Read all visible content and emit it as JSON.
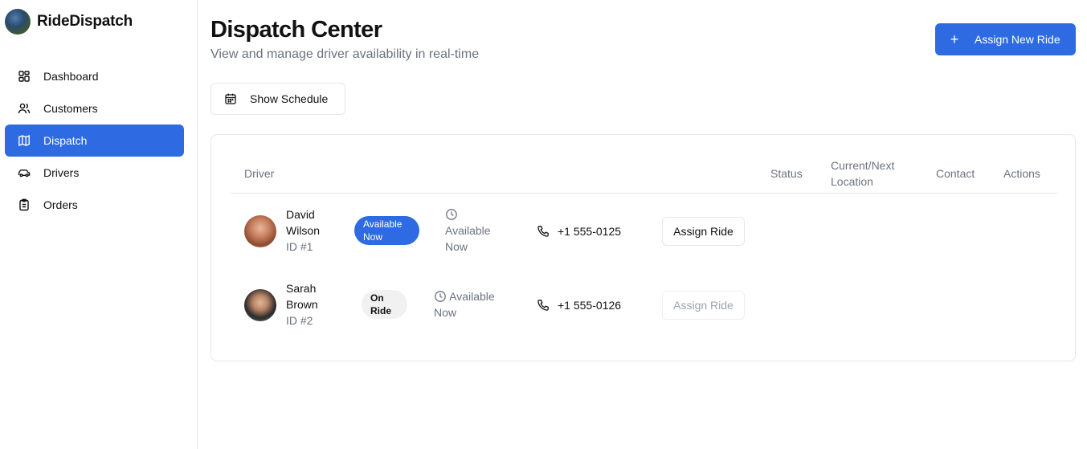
{
  "brand": {
    "name": "RideDispatch"
  },
  "sidebar": {
    "items": [
      {
        "label": "Dashboard",
        "icon": "grid-icon"
      },
      {
        "label": "Customers",
        "icon": "users-icon"
      },
      {
        "label": "Dispatch",
        "icon": "map-icon",
        "active": true
      },
      {
        "label": "Drivers",
        "icon": "car-icon"
      },
      {
        "label": "Orders",
        "icon": "clipboard-icon"
      }
    ]
  },
  "header": {
    "title": "Dispatch Center",
    "subtitle": "View and manage driver availability in real-time",
    "assign_new_label": "Assign New Ride",
    "show_schedule_label": "Show Schedule"
  },
  "table": {
    "columns": [
      "Driver",
      "Status",
      "Current/Next\nLocation",
      "Contact",
      "Actions"
    ],
    "rows": [
      {
        "first": "David",
        "last": "Wilson",
        "id": "ID #1",
        "status": "Available Now",
        "location": "Available Now",
        "phone": "+1 555-0125",
        "action": "Assign Ride",
        "action_enabled": true
      },
      {
        "first": "Sarah",
        "last": "Brown",
        "id": "ID #2",
        "status": "On Ride",
        "location": "Available Now",
        "phone": "+1 555-0126",
        "action": "Assign Ride",
        "action_enabled": false
      }
    ]
  },
  "colors": {
    "accent": "#2e6be3",
    "muted": "#6b7280",
    "border": "#e5e7eb"
  }
}
